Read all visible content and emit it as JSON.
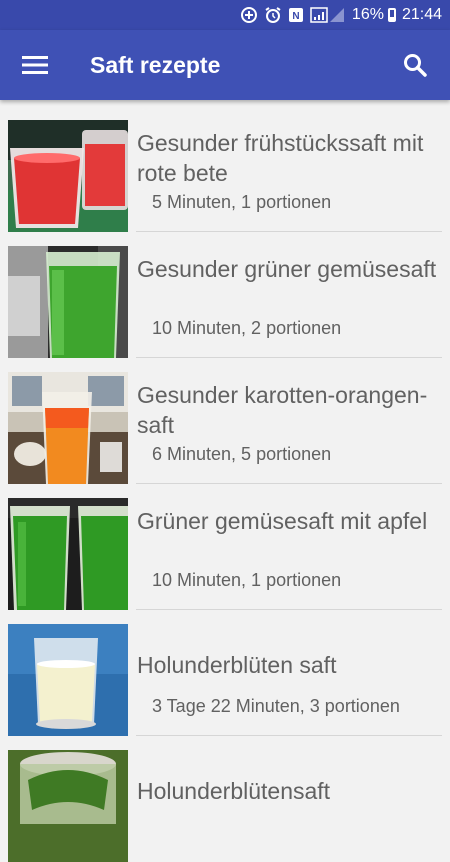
{
  "status_bar": {
    "battery_percent": "16%",
    "time": "21:44",
    "icons": [
      "data-saver-icon",
      "alarm-icon",
      "nfc-icon",
      "signal-icon",
      "battery-icon"
    ]
  },
  "app_bar": {
    "title": "Saft rezepte",
    "menu_icon": "hamburger-menu-icon",
    "search_icon": "search-icon",
    "background": "#3f51b5"
  },
  "recipes": [
    {
      "title": "Gesunder frühstückssaft mit rote bete",
      "meta": "5 Minuten, 1 portionen",
      "image": "red-juice-glasses"
    },
    {
      "title": "Gesunder grüner gemüsesaft",
      "meta": "10 Minuten, 2 portionen",
      "image": "green-juice-glass"
    },
    {
      "title": "Gesunder karotten-orangen-saft",
      "meta": "6 Minuten, 5 portionen",
      "image": "orange-juice-glass"
    },
    {
      "title": "Grüner gemüsesaft mit apfel",
      "meta": "10 Minuten, 1 portionen",
      "image": "green-juice-glasses"
    },
    {
      "title": "Holunderblüten saft",
      "meta": "3 Tage 22 Minuten, 3 portionen",
      "image": "elderflower-juice-glass"
    },
    {
      "title": "Holunderblütensaft",
      "meta": "",
      "image": "elderflower-jar"
    }
  ]
}
